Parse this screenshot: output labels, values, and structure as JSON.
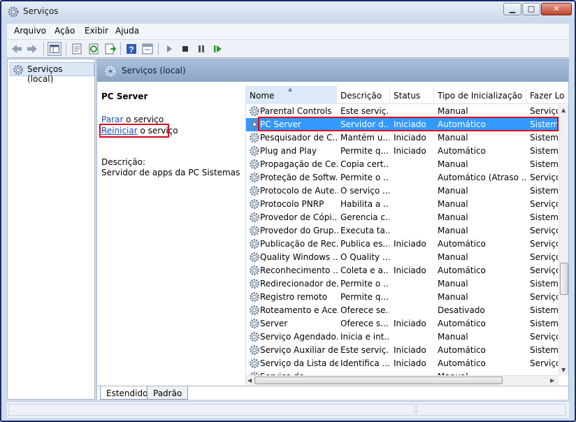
{
  "window": {
    "title": "Serviços",
    "controls": {
      "minimize": "▁",
      "maximize": "□",
      "close": "✕"
    }
  },
  "menu": [
    "Arquivo",
    "Ação",
    "Exibir",
    "Ajuda"
  ],
  "toolbar": {
    "icons": [
      "back-icon",
      "forward-icon",
      "show-hide-tree-icon",
      "properties-icon",
      "refresh-icon",
      "export-list-icon",
      "help-icon",
      "view-icon",
      "start-service-icon",
      "stop-service-icon",
      "pause-service-icon",
      "restart-service-icon"
    ]
  },
  "tree": {
    "root_label": "Serviços (local)"
  },
  "header": {
    "title": "Serviços (local)"
  },
  "details": {
    "service_name": "PC Server",
    "stop_link": "Parar",
    "stop_suffix": " o serviço",
    "restart_link": "Reiniciar",
    "restart_suffix": " o serviço",
    "description_label": "Descrição:",
    "description_text": "Servidor de apps da PC Sistemas"
  },
  "columns": [
    "Nome",
    "Descrição",
    "Status",
    "Tipo de Inicialização",
    "Fazer Lo"
  ],
  "rows": [
    [
      "Parental Controls",
      "Este serviç...",
      "",
      "Manual",
      "Serviço"
    ],
    [
      "PC Server",
      "Servidor d...",
      "Iniciado",
      "Automático",
      "Sistema"
    ],
    [
      "Pesquisador de C...",
      "Mantém u...",
      "Iniciado",
      "Manual",
      "Sistema"
    ],
    [
      "Plug and Play",
      "Permite q...",
      "Iniciado",
      "Automático",
      "Sistema"
    ],
    [
      "Propagação de Ce...",
      "Copia cert...",
      "",
      "Manual",
      "Sistema"
    ],
    [
      "Proteção de Softw...",
      "Permite o ...",
      "",
      "Automático (Atraso ...",
      "Serviço"
    ],
    [
      "Protocolo de Aute...",
      "O serviço ...",
      "",
      "Manual",
      "Sistema"
    ],
    [
      "Protocolo PNRP",
      "Habilita a ...",
      "",
      "Manual",
      "Serviço"
    ],
    [
      "Provedor de Cópi...",
      "Gerencia c...",
      "",
      "Manual",
      "Sistema"
    ],
    [
      "Provedor do Grup...",
      "Executa ta...",
      "",
      "Manual",
      "Serviço"
    ],
    [
      "Publicação de Rec...",
      "Publica es...",
      "Iniciado",
      "Automático",
      "Serviço"
    ],
    [
      "Quality Windows ...",
      "O Quality ...",
      "",
      "Manual",
      "Serviço"
    ],
    [
      "Reconhecimento ...",
      "Coleta e a...",
      "Iniciado",
      "Automático",
      "Serviço"
    ],
    [
      "Redirecionador de...",
      "Permite o ...",
      "",
      "Manual",
      "Sistema"
    ],
    [
      "Registro remoto",
      "Permite q...",
      "",
      "Manual",
      "Serviço"
    ],
    [
      "Roteamento e Ace...",
      "Oferece se...",
      "",
      "Desativado",
      "Sistema"
    ],
    [
      "Server",
      "Oferece s...",
      "Iniciado",
      "Automático",
      "Sistema"
    ],
    [
      "Serviço Agendado...",
      "Inicia e int...",
      "",
      "Manual",
      "Serviço"
    ],
    [
      "Serviço Auxiliar de...",
      "Este serviç...",
      "Iniciado",
      "Automático",
      "Sistema"
    ],
    [
      "Serviço da Lista de...",
      "Identifica ...",
      "Iniciado",
      "Automático",
      "Serviço"
    ],
    [
      "Serviço de ...",
      "",
      "",
      "Manual",
      ""
    ]
  ],
  "selected_row": 1,
  "tabs": [
    "Estendido",
    "Padrão"
  ],
  "active_tab": 0,
  "colors": {
    "selection": "#3399ff",
    "highlight_box": "#e0001a",
    "link": "#1a4fb0"
  }
}
